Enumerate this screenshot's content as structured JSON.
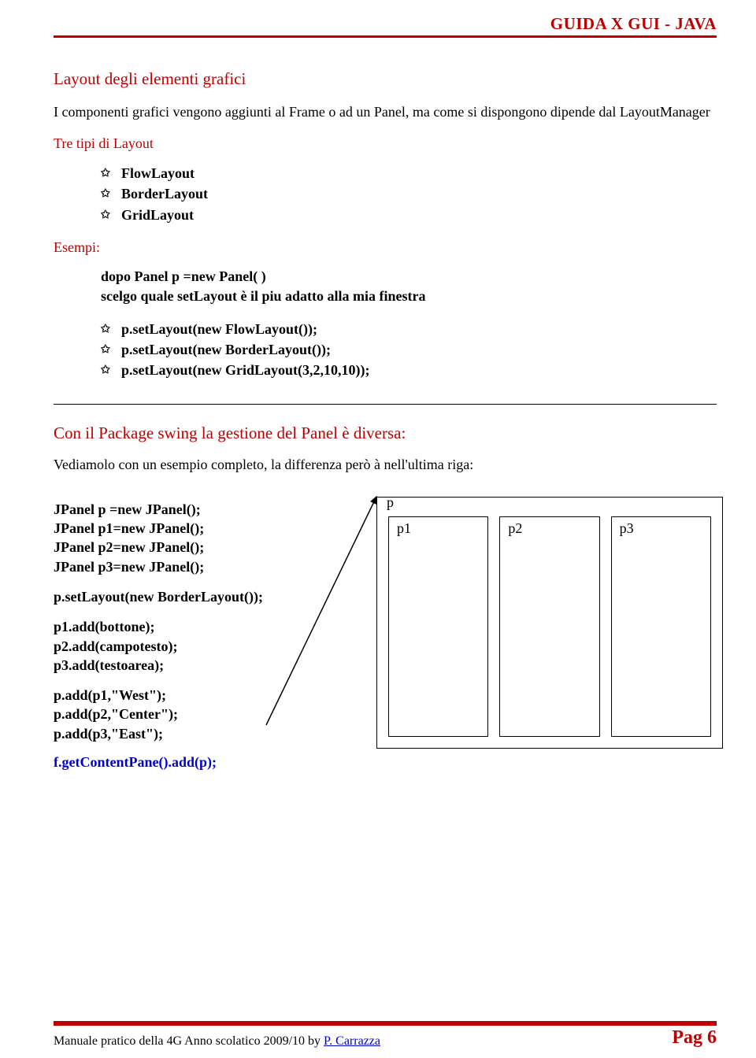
{
  "header": {
    "title": "GUIDA X GUI - JAVA"
  },
  "section1": {
    "heading": "Layout degli elementi grafici",
    "intro": "I componenti grafici vengono aggiunti al Frame o ad un Panel, ma come si dispongono dipende dal LayoutManager",
    "subheading": "Tre tipi di Layout",
    "layouts": [
      "FlowLayout",
      "BorderLayout",
      "GridLayout"
    ]
  },
  "esempi": {
    "heading": "Esempi:",
    "intro1": "dopo Panel p =new Panel( )",
    "intro2": "scelgo quale setLayout è il piu adatto alla mia finestra",
    "items": [
      "p.setLayout(new FlowLayout());",
      "p.setLayout(new BorderLayout());",
      "p.setLayout(new GridLayout(3,2,10,10));"
    ]
  },
  "swing": {
    "heading": "Con il  Package  swing la gestione del  Panel è diversa:",
    "intro": "Vediamolo con un esempio completo, la differenza però à nell'ultima riga:",
    "block1": "JPanel p =new JPanel();\nJPanel p1=new JPanel();\nJPanel p2=new JPanel();\nJPanel p3=new JPanel();",
    "line2": "p.setLayout(new BorderLayout());",
    "block3": "p1.add(bottone);\np2.add(campotesto);\np3.add(testoarea);",
    "block4": "p.add(p1,\"West\");\np.add(p2,\"Center\");\np.add(p3,\"East\");",
    "final": "f.getContentPane().add(p);"
  },
  "diagram": {
    "p": "p",
    "p1": "p1",
    "p2": "p2",
    "p3": "p3"
  },
  "footer": {
    "text": "Manuale pratico della 4G Anno scolatico 2009/10 by ",
    "author": "P. Carrazza",
    "page": "Pag 6"
  }
}
